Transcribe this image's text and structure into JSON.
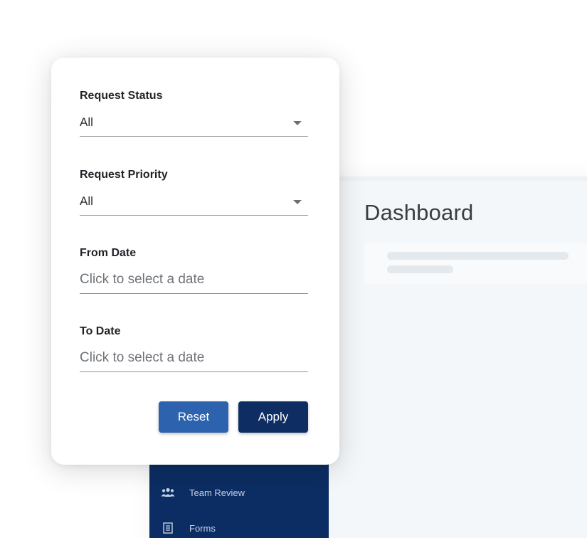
{
  "filter": {
    "status": {
      "label": "Request Status",
      "value": "All"
    },
    "priority": {
      "label": "Request Priority",
      "value": "All"
    },
    "from_date": {
      "label": "From Date",
      "placeholder": "Click to select a date"
    },
    "to_date": {
      "label": "To Date",
      "placeholder": "Click to select a date"
    },
    "reset_label": "Reset",
    "apply_label": "Apply"
  },
  "main": {
    "title": "Dashboard"
  },
  "sidebar": {
    "items": [
      {
        "label": "Team Review",
        "icon": "team-icon"
      },
      {
        "label": "Forms",
        "icon": "forms-icon"
      }
    ]
  },
  "colors": {
    "sidebar_bg": "#0c2d63",
    "reset_button": "#2d63ae",
    "apply_button": "#0e2d62"
  }
}
